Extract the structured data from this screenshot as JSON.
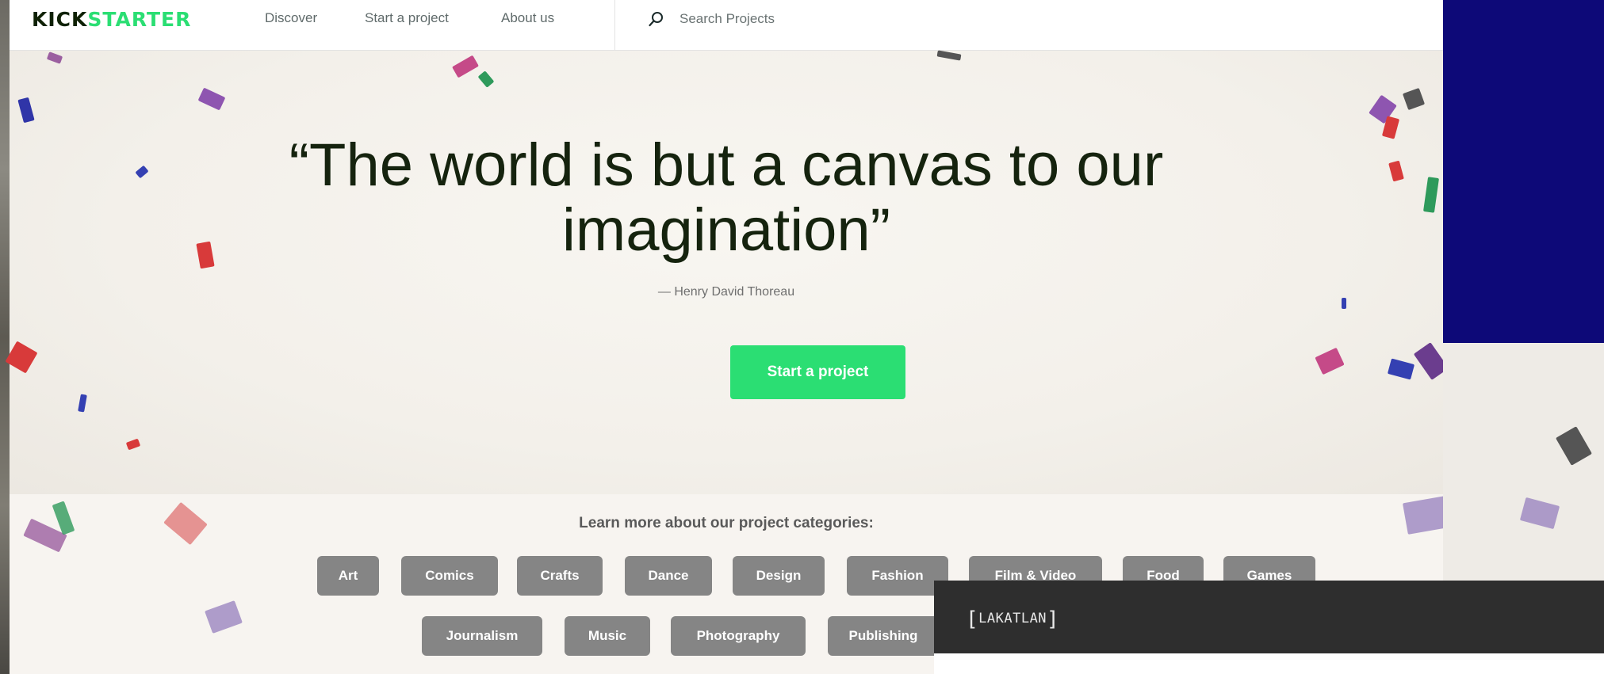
{
  "header": {
    "logo_kick": "KICK",
    "logo_starter": "STARTER",
    "nav": [
      "Discover",
      "Start a project",
      "About us"
    ],
    "search_placeholder": "Search Projects"
  },
  "hero": {
    "quote_line1": "“The world is but a canvas to our",
    "quote_line2": "imagination”",
    "attribution": "— Henry David Thoreau",
    "cta_label": "Start a project"
  },
  "categories": {
    "heading": "Learn more about our project categories:",
    "row1": [
      "Art",
      "Comics",
      "Crafts",
      "Dance",
      "Design",
      "Fashion",
      "Film & Video",
      "Food",
      "Games"
    ],
    "row2": [
      "Journalism",
      "Music",
      "Photography",
      "Publishing"
    ]
  },
  "overlay_bar": {
    "label": "LAKATLAN"
  },
  "colors": {
    "brand_green": "#2bde73",
    "panel_blue": "#0d0978",
    "pill_gray": "#858585"
  }
}
